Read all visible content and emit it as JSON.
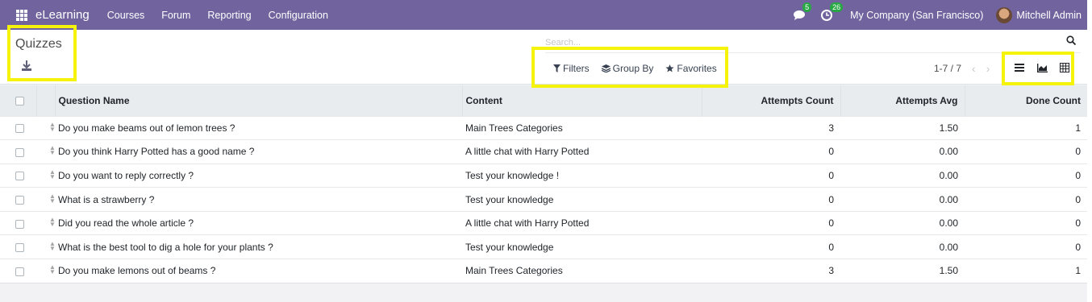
{
  "navbar": {
    "app_name": "eLearning",
    "menu": [
      "Courses",
      "Forum",
      "Reporting",
      "Configuration"
    ],
    "messages_badge": "5",
    "activities_badge": "26",
    "company": "My Company (San Francisco)",
    "user": "Mitchell Admin"
  },
  "control_panel": {
    "title": "Quizzes",
    "search_placeholder": "Search...",
    "filters_label": "Filters",
    "group_by_label": "Group By",
    "favorites_label": "Favorites",
    "pager": "1-7 / 7",
    "views": [
      "list-view",
      "graph-view",
      "pivot-view"
    ]
  },
  "table": {
    "columns": [
      "Question Name",
      "Content",
      "Attempts Count",
      "Attempts Avg",
      "Done Count"
    ],
    "rows": [
      [
        "Do you make beams out of lemon trees ?",
        "Main Trees Categories",
        "3",
        "1.50",
        "1"
      ],
      [
        "Do you think Harry Potted has a good name ?",
        "A little chat with Harry Potted",
        "0",
        "0.00",
        "0"
      ],
      [
        "Do you want to reply correctly ?",
        "Test your knowledge !",
        "0",
        "0.00",
        "0"
      ],
      [
        "What is a strawberry ?",
        "Test your knowledge",
        "0",
        "0.00",
        "0"
      ],
      [
        "Did you read the whole article ?",
        "A little chat with Harry Potted",
        "0",
        "0.00",
        "0"
      ],
      [
        "What is the best tool to dig a hole for your plants ?",
        "Test your knowledge",
        "0",
        "0.00",
        "0"
      ],
      [
        "Do you make lemons out of beams ?",
        "Main Trees Categories",
        "3",
        "1.50",
        "1"
      ]
    ]
  },
  "colors": {
    "navbar": "#71639e",
    "highlight": "#f5f30a",
    "badge": "#28a745"
  }
}
